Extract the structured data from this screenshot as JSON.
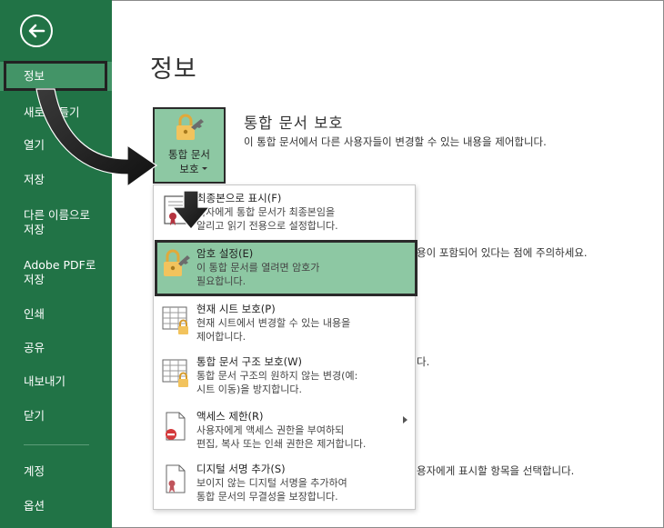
{
  "sidebar": {
    "items": [
      {
        "label": "정보",
        "selected": true
      },
      {
        "label": "새로 만들기"
      },
      {
        "label": "열기"
      },
      {
        "label": "저장"
      },
      {
        "label": "다른 이름으로\n저장"
      },
      {
        "label": "Adobe PDF로\n저장"
      },
      {
        "label": "인쇄"
      },
      {
        "label": "공유"
      },
      {
        "label": "내보내기"
      },
      {
        "label": "닫기"
      },
      {
        "label": "계정"
      },
      {
        "label": "옵션"
      }
    ],
    "color": "#217346"
  },
  "main": {
    "page_title": "정보",
    "protect_button_label": "통합 문서\n보호",
    "section_title": "통합 문서 보호",
    "section_desc": "이 통합 문서에서 다른 사용자들이 변경할 수 있는 내용을 제어합니다.",
    "bg_fragment_1": "용이 포함되어 있다는 점에 주의하세요.",
    "bg_fragment_2": "다.",
    "bg_fragment_3": "용자에게 표시할 항목을 선택합니다."
  },
  "menu": {
    "items": [
      {
        "title": "최종본으로 표시(F)",
        "desc": "독자에게 통합 문서가 최종본임을\n알리고 읽기 전용으로 설정합니다.",
        "icon": "final-doc-icon"
      },
      {
        "title": "암호 설정(E)",
        "desc": "이 통합 문서를 열려면 암호가\n필요합니다.",
        "icon": "lock-key-icon",
        "highlighted": true
      },
      {
        "title": "현재 시트 보호(P)",
        "desc": "현재 시트에서 변경할 수 있는 내용을\n제어합니다.",
        "icon": "sheet-lock-icon"
      },
      {
        "title": "통합 문서 구조 보호(W)",
        "desc": "통합 문서 구조의 원하지 않는 변경(예:\n시트 이동)을 방지합니다.",
        "icon": "structure-lock-icon"
      },
      {
        "title": "액세스 제한(R)",
        "desc": "사용자에게 액세스 권한을 부여하되\n편집, 복사 또는 인쇄 권한은 제거합니다.",
        "icon": "restrict-access-icon",
        "has_submenu": true
      },
      {
        "title": "디지털 서명 추가(S)",
        "desc": "보이지 않는 디지털 서명을 추가하여\n통합 문서의 무결성을 보장합니다.",
        "icon": "signature-icon"
      }
    ]
  },
  "colors": {
    "accent": "#217346",
    "highlight": "#8dc8a3",
    "lock": "#f0c060"
  }
}
